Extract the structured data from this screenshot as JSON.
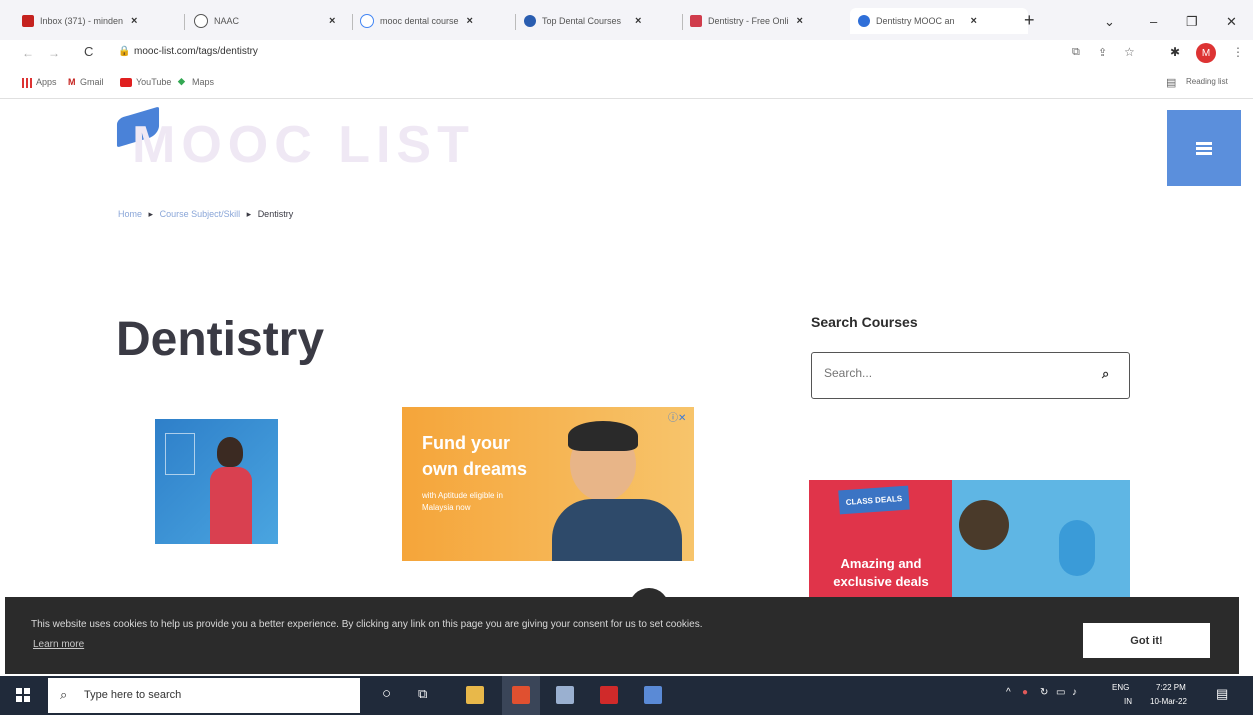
{
  "browser": {
    "tabs": [
      {
        "label": "Inbox (371) - minden",
        "icon": "gmail-icon",
        "color": "#c5221f"
      },
      {
        "label": "NAAC",
        "icon": "globe-icon",
        "color": "#555555"
      },
      {
        "label": "mooc dental course",
        "icon": "google-icon",
        "color": "#4285f4"
      },
      {
        "label": "Top Dental Courses",
        "icon": "site-icon",
        "color": "#2a5db0"
      },
      {
        "label": "Dentistry - Free Onli",
        "icon": "site-icon",
        "color": "#d03c4c"
      },
      {
        "label": "Dentistry MOOC an",
        "icon": "site-icon",
        "color": "#2f6fd8"
      }
    ],
    "new_tab_label": "+",
    "url": "mooc-list.com/tags/dentistry",
    "bookmarks": [
      {
        "label": "Apps",
        "icon": "apps-icon"
      },
      {
        "label": "Gmail",
        "icon": "gmail-icon"
      },
      {
        "label": "YouTube",
        "icon": "youtube-icon"
      },
      {
        "label": "Maps",
        "icon": "maps-icon"
      }
    ],
    "reading_list": "Reading list",
    "profile_initial": "M"
  },
  "page": {
    "logo_text": "MOOC LIST",
    "breadcrumb": [
      "Home",
      "Course Subject/Skill",
      "Dentistry"
    ],
    "title": "Dentistry",
    "search_heading": "Search Courses",
    "search_placeholder": "Search...",
    "ad_middle": {
      "line1": "Fund your",
      "line2": "own dreams",
      "line3": "with Aptitude eligible in",
      "line4": "Malaysia now"
    },
    "ad_right": {
      "brand": "CLASS DEALS",
      "line1": "Amazing and",
      "line2": "exclusive deals"
    }
  },
  "cookie": {
    "message": "This website uses cookies to help us provide you a better experience. By clicking any link on this page you are giving your consent for us to set cookies.",
    "learn_more": "Learn more",
    "button": "Got it!"
  },
  "taskbar": {
    "search_placeholder": "Type here to search",
    "lang": "ENG",
    "region": "IN",
    "time": "7:22 PM",
    "date": "10-Mar-22"
  },
  "colors": {
    "menu_blue": "#5b8fdc",
    "accent_orange": "#f5a53a",
    "ad_red": "#e0344a",
    "taskbar": "#202a3a"
  }
}
